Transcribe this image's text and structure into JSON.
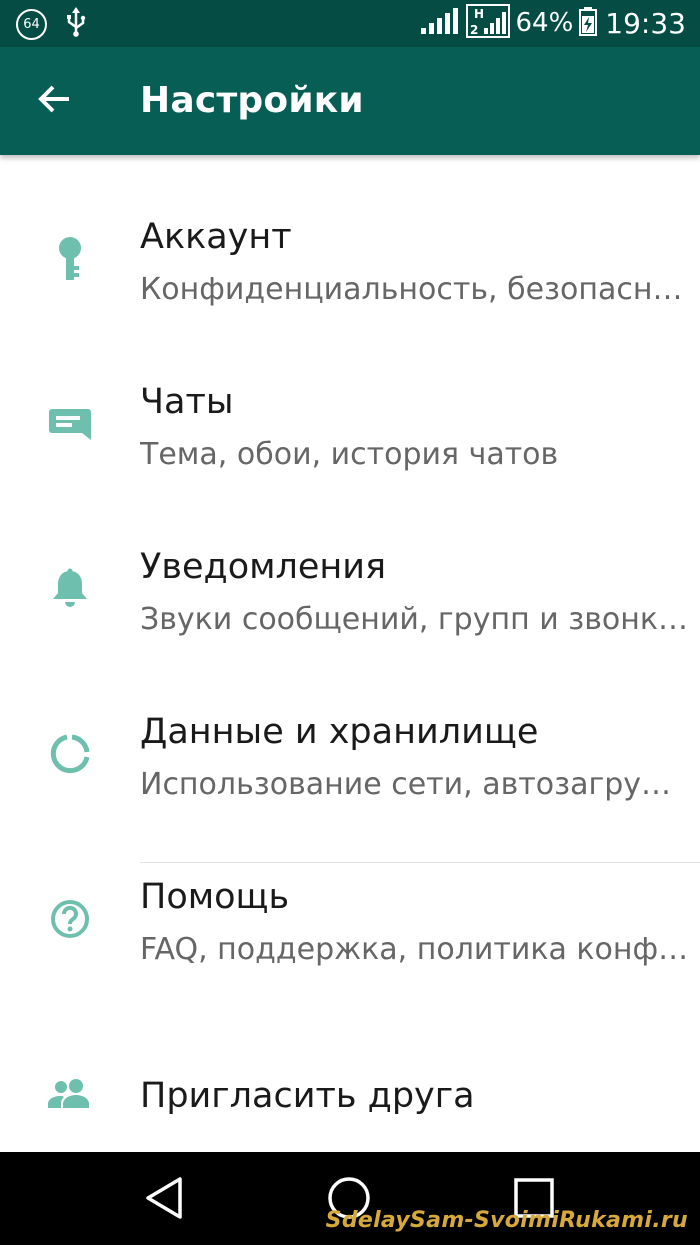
{
  "status_bar": {
    "badge": "64",
    "battery_percent": "64%",
    "time": "19:33",
    "icons": [
      "notification-64-icon",
      "usb-icon",
      "signal-icon",
      "h-signal-icon",
      "battery-charging-icon"
    ]
  },
  "toolbar": {
    "back_icon": "arrow-back-icon",
    "title": "Настройки"
  },
  "settings": [
    {
      "icon": "key-icon",
      "title": "Аккаунт",
      "subtitle": "Конфиденциальность, безопасн…"
    },
    {
      "icon": "chat-icon",
      "title": "Чаты",
      "subtitle": "Тема, обои, история чатов"
    },
    {
      "icon": "bell-icon",
      "title": "Уведомления",
      "subtitle": "Звуки сообщений, групп и звонк…"
    },
    {
      "icon": "data-usage-icon",
      "title": "Данные и хранилище",
      "subtitle": "Использование сети, автозагру…"
    },
    {
      "icon": "help-icon",
      "title": "Помощь",
      "subtitle": "FAQ, поддержка, политика конф…"
    }
  ],
  "invite": {
    "icon": "people-icon",
    "title": "Пригласить друга"
  },
  "nav_bar": {
    "buttons": [
      "back-triangle-icon",
      "home-circle-icon",
      "recents-square-icon"
    ],
    "watermark": "SdelaySam-SvoimiRukami.ru"
  },
  "colors": {
    "toolbar": "#075e54",
    "status_bar": "#054d44",
    "icon_accent": "#6fbfaf"
  }
}
